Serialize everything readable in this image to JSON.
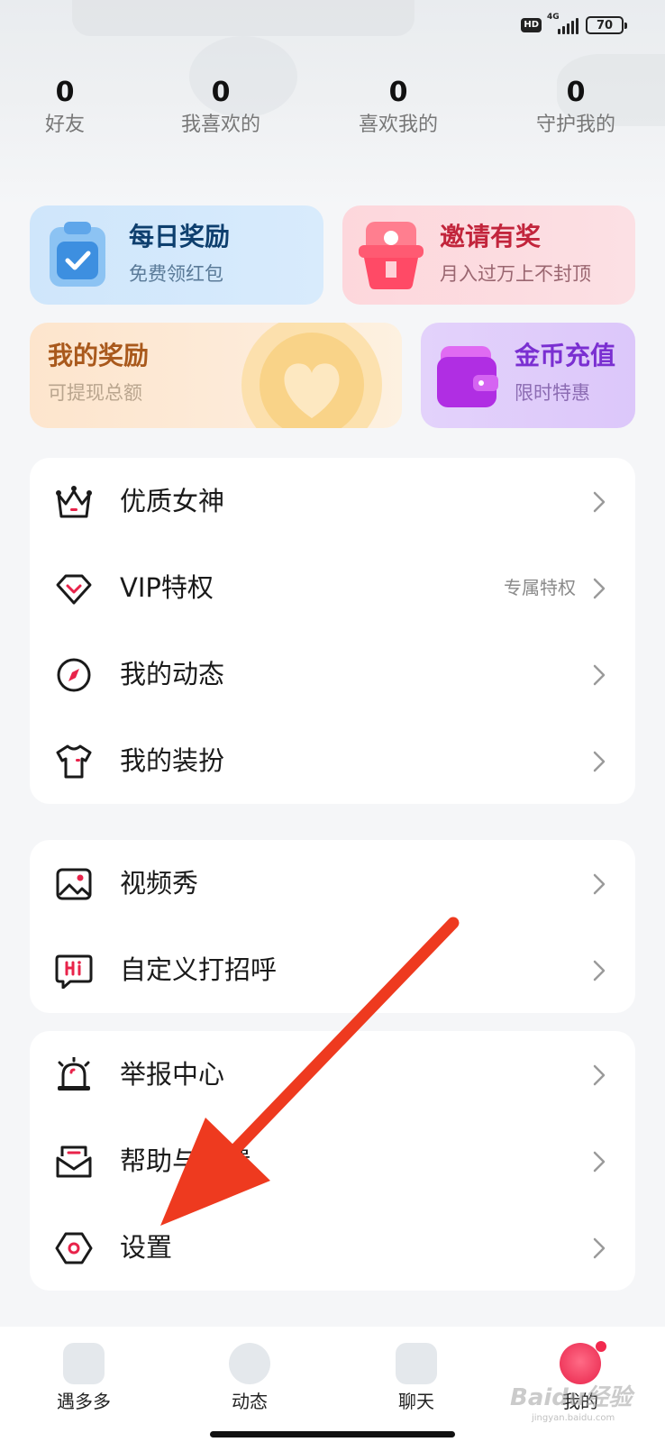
{
  "status_bar": {
    "hd": "HD",
    "network": "4G",
    "battery": "70"
  },
  "stats": [
    {
      "value": "0",
      "label": "好友"
    },
    {
      "value": "0",
      "label": "我喜欢的"
    },
    {
      "value": "0",
      "label": "喜欢我的"
    },
    {
      "value": "0",
      "label": "守护我的"
    }
  ],
  "cards": {
    "daily": {
      "title": "每日奖励",
      "subtitle": "免费领红包"
    },
    "invite": {
      "title": "邀请有奖",
      "subtitle": "月入过万上不封顶"
    },
    "my_reward": {
      "title": "我的奖励",
      "subtitle": "可提现总额"
    },
    "coin": {
      "title": "金币充值",
      "subtitle": "限时特惠"
    }
  },
  "menu_group_1": [
    {
      "label": "优质女神",
      "icon": "crown-icon"
    },
    {
      "label": "VIP特权",
      "extra": "专属特权",
      "icon": "diamond-icon"
    },
    {
      "label": "我的动态",
      "icon": "compass-icon"
    },
    {
      "label": "我的装扮",
      "icon": "tshirt-icon"
    }
  ],
  "menu_group_2": [
    {
      "label": "视频秀",
      "icon": "image-icon"
    },
    {
      "label": "自定义打招呼",
      "icon": "hi-icon"
    }
  ],
  "menu_group_3": [
    {
      "label": "举报中心",
      "icon": "alarm-icon"
    },
    {
      "label": "帮助与反馈",
      "icon": "mail-icon"
    },
    {
      "label": "设置",
      "icon": "settings-icon"
    }
  ],
  "tabbar": [
    {
      "label": "遇多多"
    },
    {
      "label": "动态"
    },
    {
      "label": "聊天"
    },
    {
      "label": "我的"
    }
  ],
  "watermark": {
    "text": "Baidu经验",
    "url": "jingyan.baidu.com"
  },
  "colors": {
    "accent": "#e8234a",
    "annotation_arrow": "#ee3a1f"
  }
}
